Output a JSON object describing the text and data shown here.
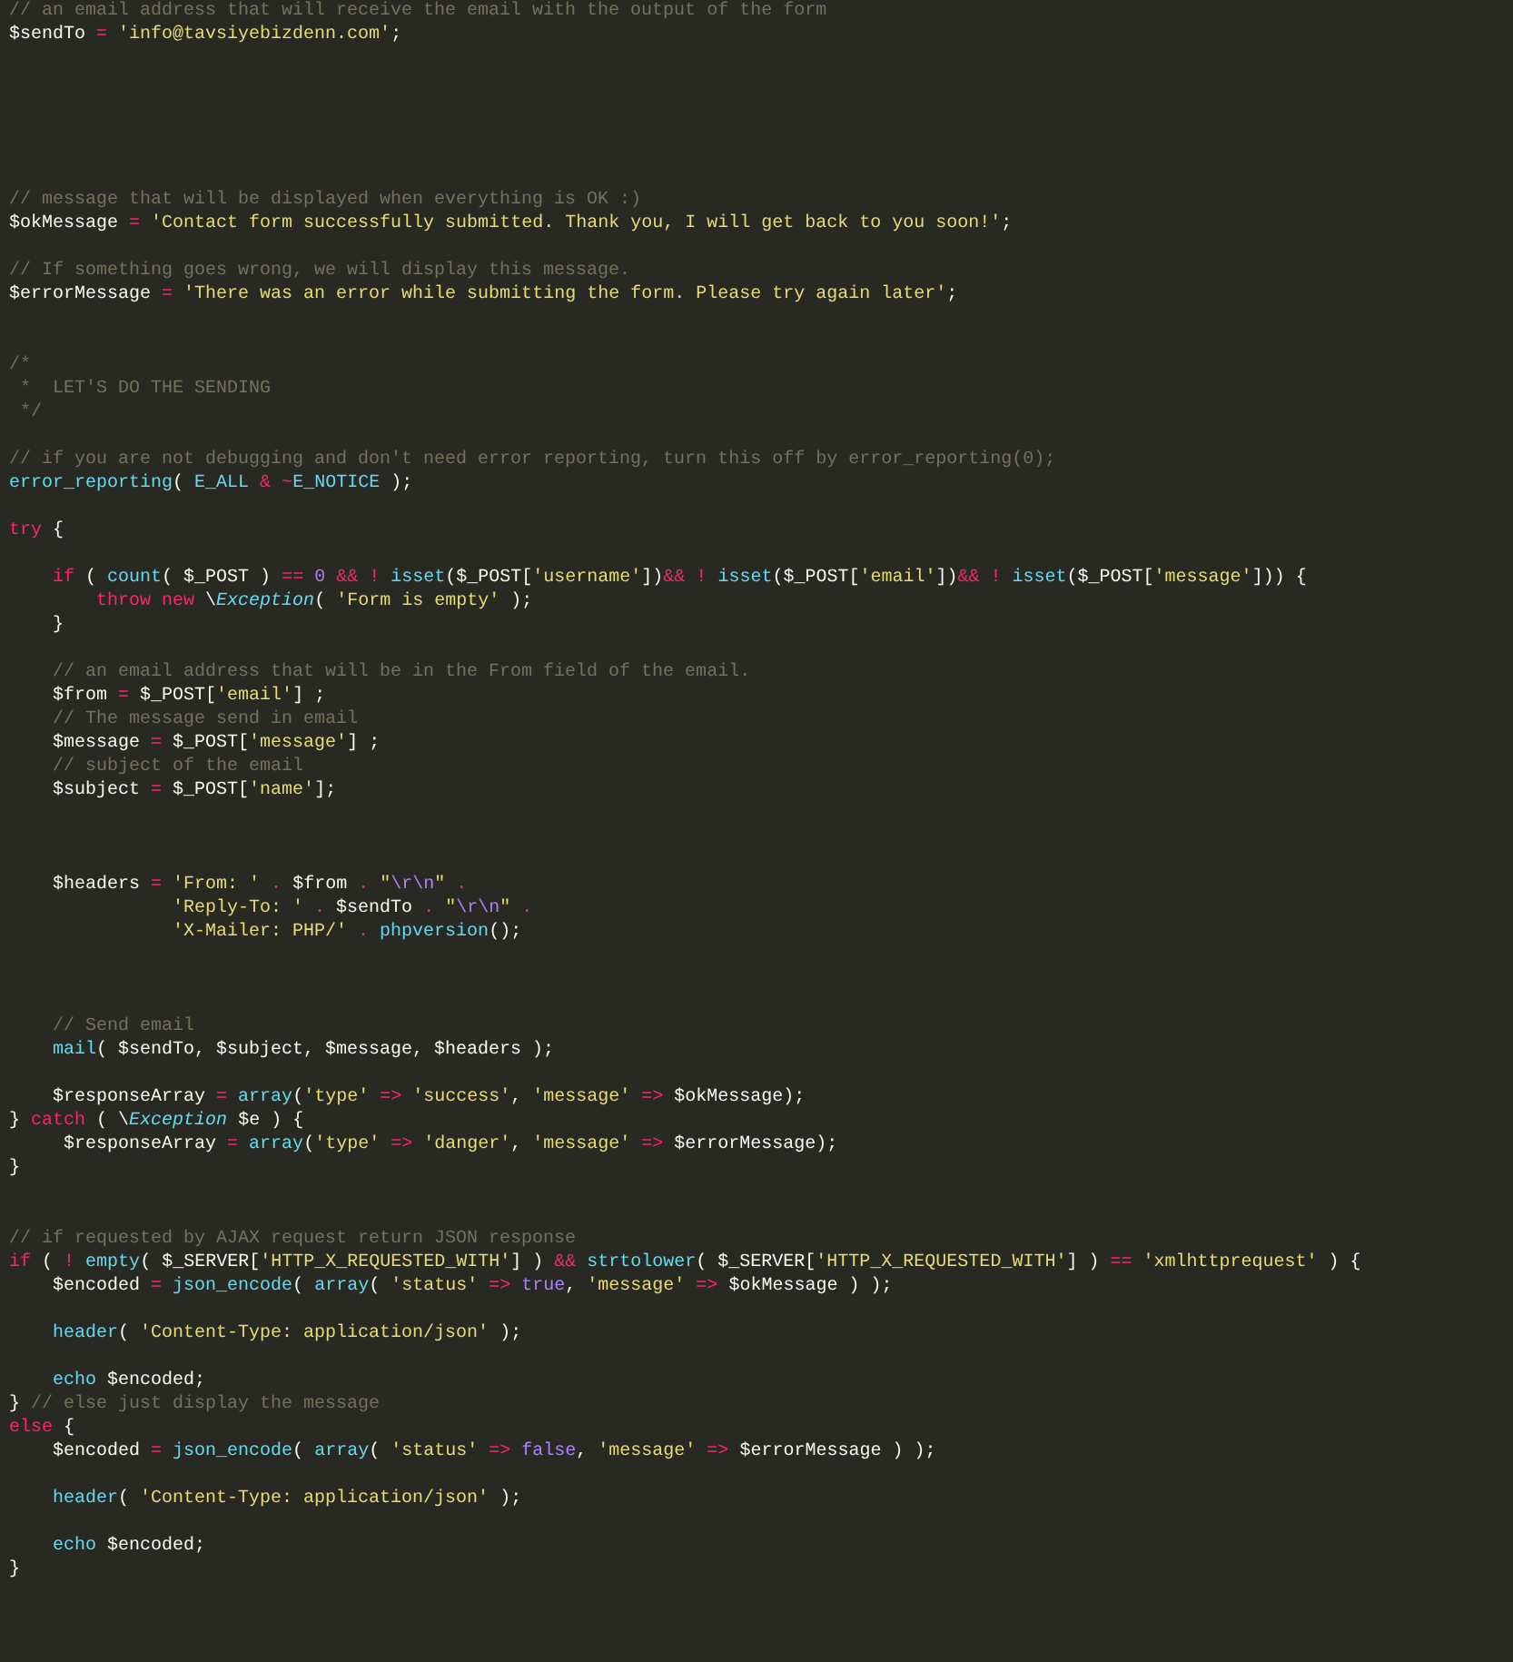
{
  "editor": {
    "lines": [
      {
        "kind": "code",
        "tokens": [
          {
            "kind": "comment",
            "text": "// an email address that will receive the email with the output of the form"
          }
        ]
      },
      {
        "kind": "code",
        "tokens": [
          {
            "kind": "plain",
            "text": "$sendTo "
          },
          {
            "kind": "op",
            "text": "= "
          },
          {
            "kind": "str",
            "text": "'info@tavsiyebizdenn.com'"
          },
          {
            "kind": "plain",
            "text": ";"
          }
        ]
      },
      {
        "kind": "blank"
      },
      {
        "kind": "blank"
      },
      {
        "kind": "blank"
      },
      {
        "kind": "blank"
      },
      {
        "kind": "blank"
      },
      {
        "kind": "blank"
      },
      {
        "kind": "code",
        "tokens": [
          {
            "kind": "comment",
            "text": "// message that will be displayed when everything is OK :)"
          }
        ]
      },
      {
        "kind": "code",
        "tokens": [
          {
            "kind": "plain",
            "text": "$okMessage "
          },
          {
            "kind": "op",
            "text": "= "
          },
          {
            "kind": "str",
            "text": "'Contact form successfully submitted. Thank you, I will get back to you soon!'"
          },
          {
            "kind": "plain",
            "text": ";"
          }
        ]
      },
      {
        "kind": "blank"
      },
      {
        "kind": "code",
        "tokens": [
          {
            "kind": "comment",
            "text": "// If something goes wrong, we will display this message."
          }
        ]
      },
      {
        "kind": "code",
        "tokens": [
          {
            "kind": "plain",
            "text": "$errorMessage "
          },
          {
            "kind": "op",
            "text": "= "
          },
          {
            "kind": "str",
            "text": "'There was an error while submitting the form. Please try again later'"
          },
          {
            "kind": "plain",
            "text": ";"
          }
        ]
      },
      {
        "kind": "blank"
      },
      {
        "kind": "blank"
      },
      {
        "kind": "code",
        "tokens": [
          {
            "kind": "comment",
            "text": "/*"
          }
        ]
      },
      {
        "kind": "code",
        "tokens": [
          {
            "kind": "comment",
            "text": " *  LET'S DO THE SENDING"
          }
        ]
      },
      {
        "kind": "code",
        "tokens": [
          {
            "kind": "comment",
            "text": " */"
          }
        ]
      },
      {
        "kind": "blank"
      },
      {
        "kind": "code",
        "tokens": [
          {
            "kind": "comment",
            "text": "// if you are not debugging and don't need error reporting, turn this off by error_reporting(0);"
          }
        ]
      },
      {
        "kind": "code",
        "tokens": [
          {
            "kind": "fn",
            "text": "error_reporting"
          },
          {
            "kind": "plain",
            "text": "( "
          },
          {
            "kind": "fn",
            "text": "E_ALL "
          },
          {
            "kind": "op",
            "text": "& ~"
          },
          {
            "kind": "fn",
            "text": "E_NOTICE"
          },
          {
            "kind": "plain",
            "text": " );"
          }
        ]
      },
      {
        "kind": "blank"
      },
      {
        "kind": "code",
        "tokens": [
          {
            "kind": "op",
            "text": "try "
          },
          {
            "kind": "plain",
            "text": "{"
          }
        ]
      },
      {
        "kind": "blank"
      },
      {
        "kind": "code",
        "tokens": [
          {
            "kind": "op",
            "text": "    if "
          },
          {
            "kind": "plain",
            "text": "( "
          },
          {
            "kind": "fn",
            "text": "count"
          },
          {
            "kind": "plain",
            "text": "( $_POST ) "
          },
          {
            "kind": "op",
            "text": "== "
          },
          {
            "kind": "num",
            "text": "0 "
          },
          {
            "kind": "op",
            "text": "&& ! "
          },
          {
            "kind": "fn",
            "text": "isset"
          },
          {
            "kind": "plain",
            "text": "($_POST["
          },
          {
            "kind": "str",
            "text": "'username'"
          },
          {
            "kind": "plain",
            "text": "])"
          },
          {
            "kind": "op",
            "text": "&& ! "
          },
          {
            "kind": "fn",
            "text": "isset"
          },
          {
            "kind": "plain",
            "text": "($_POST["
          },
          {
            "kind": "str",
            "text": "'email'"
          },
          {
            "kind": "plain",
            "text": "])"
          },
          {
            "kind": "op",
            "text": "&& ! "
          },
          {
            "kind": "fn",
            "text": "isset"
          },
          {
            "kind": "plain",
            "text": "($_POST["
          },
          {
            "kind": "str",
            "text": "'message'"
          },
          {
            "kind": "plain",
            "text": "])) {"
          }
        ]
      },
      {
        "kind": "code",
        "tokens": [
          {
            "kind": "op",
            "text": "        throw new "
          },
          {
            "kind": "plain",
            "text": "\\"
          },
          {
            "kind": "cls",
            "text": "Exception"
          },
          {
            "kind": "plain",
            "text": "( "
          },
          {
            "kind": "str",
            "text": "'Form is empty'"
          },
          {
            "kind": "plain",
            "text": " );"
          }
        ]
      },
      {
        "kind": "code",
        "tokens": [
          {
            "kind": "plain",
            "text": "    }"
          }
        ]
      },
      {
        "kind": "blank"
      },
      {
        "kind": "code",
        "tokens": [
          {
            "kind": "comment",
            "text": "    // an email address that will be in the From field of the email."
          }
        ]
      },
      {
        "kind": "code",
        "tokens": [
          {
            "kind": "plain",
            "text": "    $from "
          },
          {
            "kind": "op",
            "text": "= "
          },
          {
            "kind": "plain",
            "text": "$_POST["
          },
          {
            "kind": "str",
            "text": "'email'"
          },
          {
            "kind": "plain",
            "text": "] ;"
          }
        ]
      },
      {
        "kind": "code",
        "tokens": [
          {
            "kind": "comment",
            "text": "    // The message send in email"
          }
        ]
      },
      {
        "kind": "code",
        "tokens": [
          {
            "kind": "plain",
            "text": "    $message "
          },
          {
            "kind": "op",
            "text": "= "
          },
          {
            "kind": "plain",
            "text": "$_POST["
          },
          {
            "kind": "str",
            "text": "'message'"
          },
          {
            "kind": "plain",
            "text": "] ;"
          }
        ]
      },
      {
        "kind": "code",
        "tokens": [
          {
            "kind": "comment",
            "text": "    // subject of the email"
          }
        ]
      },
      {
        "kind": "code",
        "tokens": [
          {
            "kind": "plain",
            "text": "    $subject "
          },
          {
            "kind": "op",
            "text": "= "
          },
          {
            "kind": "plain",
            "text": "$_POST["
          },
          {
            "kind": "str",
            "text": "'name'"
          },
          {
            "kind": "plain",
            "text": "];"
          }
        ]
      },
      {
        "kind": "blank"
      },
      {
        "kind": "blank"
      },
      {
        "kind": "blank"
      },
      {
        "kind": "code",
        "tokens": [
          {
            "kind": "plain",
            "text": "    $headers "
          },
          {
            "kind": "op",
            "text": "= "
          },
          {
            "kind": "str",
            "text": "'From: ' "
          },
          {
            "kind": "op",
            "text": ". "
          },
          {
            "kind": "plain",
            "text": "$from "
          },
          {
            "kind": "op",
            "text": ". "
          },
          {
            "kind": "str",
            "text": "\""
          },
          {
            "kind": "esc",
            "text": "\\r\\n"
          },
          {
            "kind": "str",
            "text": "\" "
          },
          {
            "kind": "op",
            "text": "."
          }
        ]
      },
      {
        "kind": "code",
        "tokens": [
          {
            "kind": "str",
            "text": "               'Reply-To: ' "
          },
          {
            "kind": "op",
            "text": ". "
          },
          {
            "kind": "plain",
            "text": "$sendTo "
          },
          {
            "kind": "op",
            "text": ". "
          },
          {
            "kind": "str",
            "text": "\""
          },
          {
            "kind": "esc",
            "text": "\\r\\n"
          },
          {
            "kind": "str",
            "text": "\" "
          },
          {
            "kind": "op",
            "text": "."
          }
        ]
      },
      {
        "kind": "code",
        "tokens": [
          {
            "kind": "str",
            "text": "               'X-Mailer: PHP/' "
          },
          {
            "kind": "op",
            "text": ". "
          },
          {
            "kind": "fn",
            "text": "phpversion"
          },
          {
            "kind": "plain",
            "text": "();"
          }
        ]
      },
      {
        "kind": "blank"
      },
      {
        "kind": "blank"
      },
      {
        "kind": "blank"
      },
      {
        "kind": "code",
        "tokens": [
          {
            "kind": "comment",
            "text": "    // Send email"
          }
        ]
      },
      {
        "kind": "code",
        "tokens": [
          {
            "kind": "fn",
            "text": "    mail"
          },
          {
            "kind": "plain",
            "text": "( $sendTo, $subject, $message, $headers );"
          }
        ]
      },
      {
        "kind": "blank"
      },
      {
        "kind": "code",
        "tokens": [
          {
            "kind": "plain",
            "text": "    $responseArray "
          },
          {
            "kind": "op",
            "text": "= "
          },
          {
            "kind": "fn",
            "text": "array"
          },
          {
            "kind": "plain",
            "text": "("
          },
          {
            "kind": "str",
            "text": "'type' "
          },
          {
            "kind": "op",
            "text": "=> "
          },
          {
            "kind": "str",
            "text": "'success'"
          },
          {
            "kind": "plain",
            "text": ", "
          },
          {
            "kind": "str",
            "text": "'message' "
          },
          {
            "kind": "op",
            "text": "=> "
          },
          {
            "kind": "plain",
            "text": "$okMessage);"
          }
        ]
      },
      {
        "kind": "code",
        "tokens": [
          {
            "kind": "plain",
            "text": "} "
          },
          {
            "kind": "op",
            "text": "catch "
          },
          {
            "kind": "plain",
            "text": "( \\"
          },
          {
            "kind": "cls",
            "text": "Exception"
          },
          {
            "kind": "plain",
            "text": " $e ) {"
          }
        ]
      },
      {
        "kind": "code",
        "tokens": [
          {
            "kind": "plain",
            "text": "     $responseArray "
          },
          {
            "kind": "op",
            "text": "= "
          },
          {
            "kind": "fn",
            "text": "array"
          },
          {
            "kind": "plain",
            "text": "("
          },
          {
            "kind": "str",
            "text": "'type' "
          },
          {
            "kind": "op",
            "text": "=> "
          },
          {
            "kind": "str",
            "text": "'danger'"
          },
          {
            "kind": "plain",
            "text": ", "
          },
          {
            "kind": "str",
            "text": "'message' "
          },
          {
            "kind": "op",
            "text": "=> "
          },
          {
            "kind": "plain",
            "text": "$errorMessage);"
          }
        ]
      },
      {
        "kind": "code",
        "tokens": [
          {
            "kind": "plain",
            "text": "}"
          }
        ]
      },
      {
        "kind": "blank"
      },
      {
        "kind": "blank"
      },
      {
        "kind": "code",
        "tokens": [
          {
            "kind": "comment",
            "text": "// if requested by AJAX request return JSON response"
          }
        ]
      },
      {
        "kind": "code",
        "tokens": [
          {
            "kind": "op",
            "text": "if "
          },
          {
            "kind": "plain",
            "text": "( "
          },
          {
            "kind": "op",
            "text": "! "
          },
          {
            "kind": "fn",
            "text": "empty"
          },
          {
            "kind": "plain",
            "text": "( $_SERVER["
          },
          {
            "kind": "str",
            "text": "'HTTP_X_REQUESTED_WITH'"
          },
          {
            "kind": "plain",
            "text": "] ) "
          },
          {
            "kind": "op",
            "text": "&& "
          },
          {
            "kind": "fn",
            "text": "strtolower"
          },
          {
            "kind": "plain",
            "text": "( $_SERVER["
          },
          {
            "kind": "str",
            "text": "'HTTP_X_REQUESTED_WITH'"
          },
          {
            "kind": "plain",
            "text": "] ) "
          },
          {
            "kind": "op",
            "text": "== "
          },
          {
            "kind": "str",
            "text": "'xmlhttprequest'"
          },
          {
            "kind": "plain",
            "text": " ) {"
          }
        ]
      },
      {
        "kind": "code",
        "tokens": [
          {
            "kind": "plain",
            "text": "    $encoded "
          },
          {
            "kind": "op",
            "text": "= "
          },
          {
            "kind": "fn",
            "text": "json_encode"
          },
          {
            "kind": "plain",
            "text": "( "
          },
          {
            "kind": "fn",
            "text": "array"
          },
          {
            "kind": "plain",
            "text": "( "
          },
          {
            "kind": "str",
            "text": "'status' "
          },
          {
            "kind": "op",
            "text": "=> "
          },
          {
            "kind": "num",
            "text": "true"
          },
          {
            "kind": "plain",
            "text": ", "
          },
          {
            "kind": "str",
            "text": "'message' "
          },
          {
            "kind": "op",
            "text": "=> "
          },
          {
            "kind": "plain",
            "text": "$okMessage ) );"
          }
        ]
      },
      {
        "kind": "blank"
      },
      {
        "kind": "code",
        "tokens": [
          {
            "kind": "fn",
            "text": "    header"
          },
          {
            "kind": "plain",
            "text": "( "
          },
          {
            "kind": "str",
            "text": "'Content-Type: application/json'"
          },
          {
            "kind": "plain",
            "text": " );"
          }
        ]
      },
      {
        "kind": "blank"
      },
      {
        "kind": "code",
        "tokens": [
          {
            "kind": "fn",
            "text": "    echo "
          },
          {
            "kind": "plain",
            "text": "$encoded;"
          }
        ]
      },
      {
        "kind": "code",
        "tokens": [
          {
            "kind": "plain",
            "text": "} "
          },
          {
            "kind": "comment",
            "text": "// else just display the message"
          }
        ]
      },
      {
        "kind": "code",
        "tokens": [
          {
            "kind": "op",
            "text": "else "
          },
          {
            "kind": "plain",
            "text": "{"
          }
        ]
      },
      {
        "kind": "code",
        "tokens": [
          {
            "kind": "plain",
            "text": "    $encoded "
          },
          {
            "kind": "op",
            "text": "= "
          },
          {
            "kind": "fn",
            "text": "json_encode"
          },
          {
            "kind": "plain",
            "text": "( "
          },
          {
            "kind": "fn",
            "text": "array"
          },
          {
            "kind": "plain",
            "text": "( "
          },
          {
            "kind": "str",
            "text": "'status' "
          },
          {
            "kind": "op",
            "text": "=> "
          },
          {
            "kind": "num",
            "text": "false"
          },
          {
            "kind": "plain",
            "text": ", "
          },
          {
            "kind": "str",
            "text": "'message' "
          },
          {
            "kind": "op",
            "text": "=> "
          },
          {
            "kind": "plain",
            "text": "$errorMessage ) );"
          }
        ]
      },
      {
        "kind": "blank"
      },
      {
        "kind": "code",
        "tokens": [
          {
            "kind": "fn",
            "text": "    header"
          },
          {
            "kind": "plain",
            "text": "( "
          },
          {
            "kind": "str",
            "text": "'Content-Type: application/json'"
          },
          {
            "kind": "plain",
            "text": " );"
          }
        ]
      },
      {
        "kind": "blank"
      },
      {
        "kind": "code",
        "tokens": [
          {
            "kind": "fn",
            "text": "    echo "
          },
          {
            "kind": "plain",
            "text": "$encoded;"
          }
        ]
      },
      {
        "kind": "code",
        "tokens": [
          {
            "kind": "plain",
            "text": "}"
          }
        ]
      }
    ]
  }
}
